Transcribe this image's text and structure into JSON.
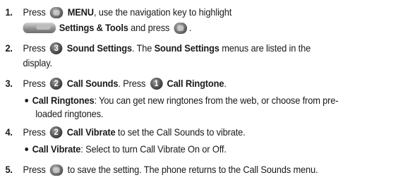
{
  "steps": [
    {
      "num": "1.",
      "lines": [
        {
          "pre": "Press ",
          "key1": "ok",
          "bold1": "MENU",
          "rest": ", use the navigation key to highlight"
        },
        {
          "icon": "settings-tools-icon",
          "bold1": "Settings & Tools",
          "rest": " and press ",
          "key2": "ok",
          "post": "."
        }
      ]
    },
    {
      "num": "2.",
      "lines": [
        {
          "pre": "Press ",
          "key_label": "3",
          "bold1": "Sound Settings",
          "rest": ". The ",
          "bold2": "Sound Settings",
          "post": " menus are listed in the"
        },
        {
          "text": "display."
        }
      ]
    },
    {
      "num": "3.",
      "lines": [
        {
          "pre": "Press ",
          "key_label": "2",
          "bold1": "Call Sounds",
          "rest": ". Press ",
          "key_label2": "1",
          "bold2": "Call Ringtone",
          "post": "."
        }
      ],
      "bullets": [
        {
          "bold": "Call Ringtones",
          "text": ": You can get new ringtones from the web, or choose from pre-",
          "cont": "loaded ringtones."
        }
      ]
    },
    {
      "num": "4.",
      "lines": [
        {
          "pre": "Press ",
          "key_label": "2",
          "bold1": "Call Vibrate",
          "rest": " to set the Call Sounds to vibrate."
        }
      ],
      "bullets": [
        {
          "bold": "Call Vibrate",
          "text": ": Select to turn Call Vibrate On or Off."
        }
      ]
    },
    {
      "num": "5.",
      "lines": [
        {
          "pre": "Press ",
          "key1": "ok",
          "rest": " to save the setting. The phone returns to the Call Sounds menu."
        }
      ]
    }
  ]
}
